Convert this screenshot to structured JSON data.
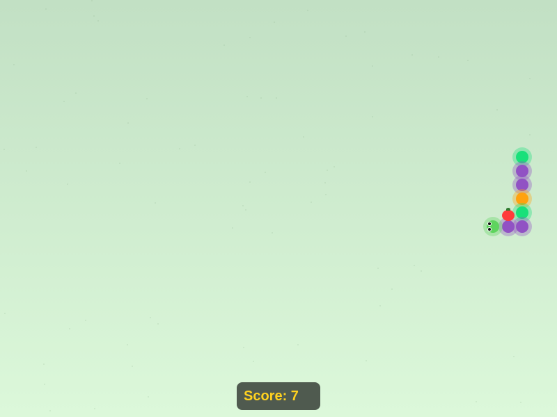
{
  "score": {
    "label": "Score: 7",
    "color": "#ffd21f",
    "background": "#4f5a4f"
  },
  "snake": {
    "head_color": "#5ed45e",
    "segments": [
      {
        "color": "#19e07a",
        "name": "green"
      },
      {
        "color": "#9152c4",
        "name": "purple"
      },
      {
        "color": "#9152c4",
        "name": "purple"
      },
      {
        "color": "#ffa20f",
        "name": "orange"
      },
      {
        "color": "#19e07a",
        "name": "green"
      },
      {
        "color": "#9152c4",
        "name": "purple"
      },
      {
        "color": "#9152c4",
        "name": "purple"
      }
    ]
  },
  "food": {
    "icon": "apple-icon",
    "color": "#ff3b3b",
    "leaf_color": "#2f7a2f"
  },
  "colors": {
    "background_top": "#c2e0c4",
    "background_bottom": "#dcf8da"
  }
}
